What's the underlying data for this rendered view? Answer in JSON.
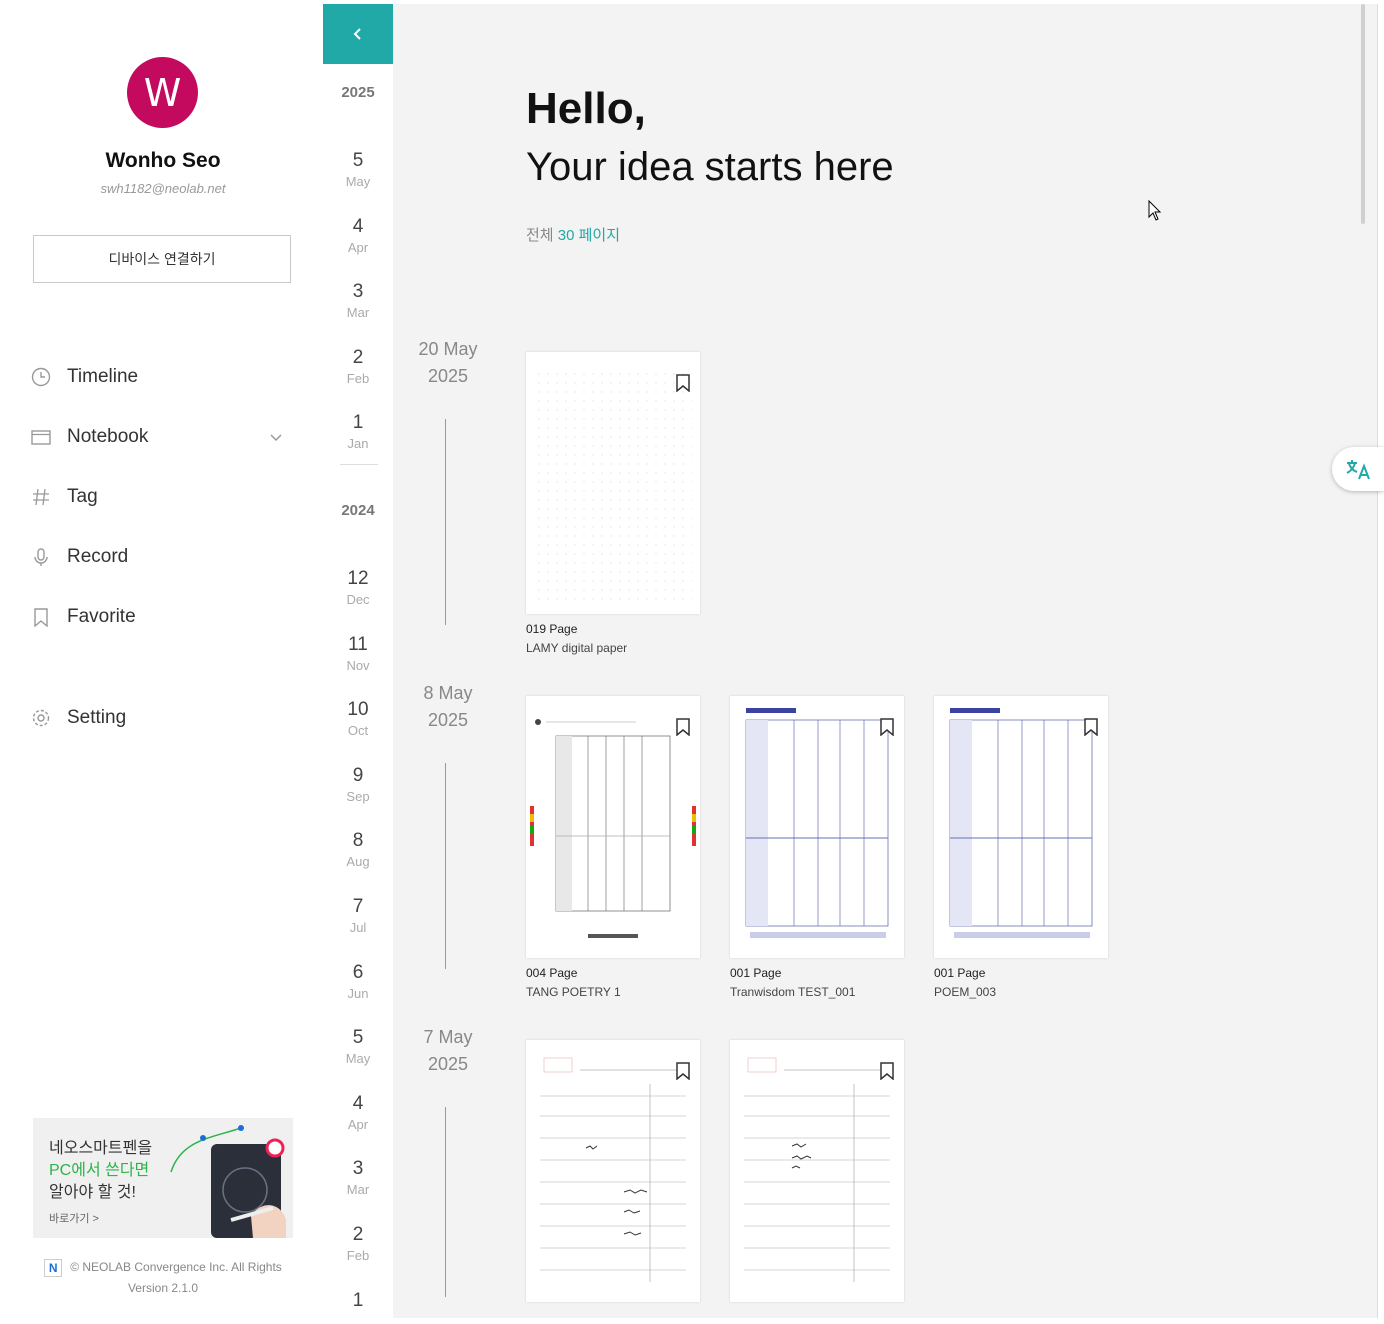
{
  "user": {
    "initial": "W",
    "name": "Wonho Seo",
    "email": "swh1182@neolab.net"
  },
  "connect_button": "디바이스 연결하기",
  "nav": {
    "timeline": "Timeline",
    "notebook": "Notebook",
    "tag": "Tag",
    "record": "Record",
    "favorite": "Favorite",
    "setting": "Setting"
  },
  "promo": {
    "line1": "네오스마트펜을",
    "line2": "PC에서 쓴다면",
    "line3": "알아야 할 것!",
    "link": "바로가기 >"
  },
  "footer": {
    "copyright": "© NEOLAB Convergence Inc. All Rights",
    "version": "Version 2.1.0",
    "logo": "N"
  },
  "rail": {
    "years": [
      "2025",
      "2024"
    ],
    "months_2025": [
      {
        "num": "5",
        "name": "May"
      },
      {
        "num": "4",
        "name": "Apr"
      },
      {
        "num": "3",
        "name": "Mar"
      },
      {
        "num": "2",
        "name": "Feb"
      },
      {
        "num": "1",
        "name": "Jan"
      }
    ],
    "months_2024": [
      {
        "num": "12",
        "name": "Dec"
      },
      {
        "num": "11",
        "name": "Nov"
      },
      {
        "num": "10",
        "name": "Oct"
      },
      {
        "num": "9",
        "name": "Sep"
      },
      {
        "num": "8",
        "name": "Aug"
      },
      {
        "num": "7",
        "name": "Jul"
      },
      {
        "num": "6",
        "name": "Jun"
      },
      {
        "num": "5",
        "name": "May"
      },
      {
        "num": "4",
        "name": "Apr"
      },
      {
        "num": "3",
        "name": "Mar"
      },
      {
        "num": "2",
        "name": "Feb"
      },
      {
        "num": "1",
        "name": ""
      }
    ]
  },
  "header": {
    "hello": "Hello,",
    "tagline": "Your idea starts here",
    "count_prefix": "전체",
    "count_value": "30 페이지"
  },
  "groups": [
    {
      "day": "20 May",
      "year": "2025",
      "pages": [
        {
          "page": "019 Page",
          "notebook": "LAMY digital paper"
        }
      ]
    },
    {
      "day": "8 May",
      "year": "2025",
      "pages": [
        {
          "page": "004 Page",
          "notebook": "TANG POETRY 1"
        },
        {
          "page": "001 Page",
          "notebook": "Tranwisdom TEST_001"
        },
        {
          "page": "001 Page",
          "notebook": "POEM_003"
        }
      ]
    },
    {
      "day": "7 May",
      "year": "2025",
      "pages": [
        {
          "page": "",
          "notebook": ""
        },
        {
          "page": "",
          "notebook": ""
        }
      ]
    }
  ],
  "translate_icon": "translate-icon",
  "accent_color": "#21a9a7",
  "avatar_color": "#c40a5e"
}
